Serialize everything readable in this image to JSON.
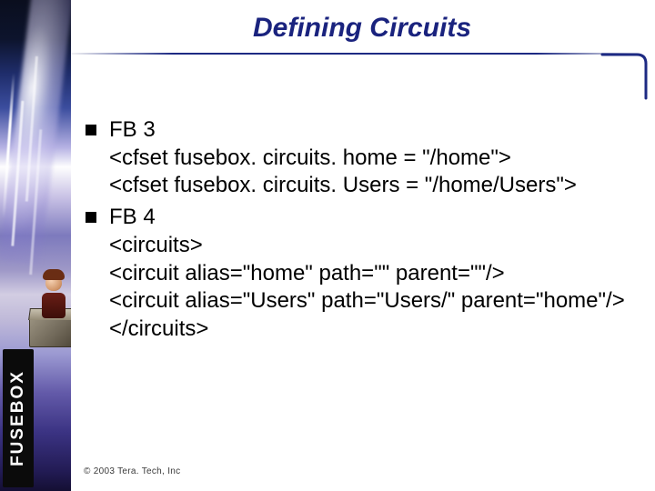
{
  "title": "Defining Circuits",
  "brand": "FUSEBOX",
  "bullets": [
    {
      "heading": "FB 3",
      "lines": [
        "<cfset fusebox. circuits. home = \"/home\">",
        "<cfset fusebox. circuits. Users = \"/home/Users\">"
      ]
    },
    {
      "heading": "FB 4",
      "lines": [
        "<circuits>",
        "  <circuit alias=\"home\" path=\"\" parent=\"\"/>",
        "  <circuit alias=\"Users\" path=\"Users/\" parent=\"home\"/>",
        "</circuits>"
      ]
    }
  ],
  "footer": "© 2003 Tera. Tech, Inc"
}
